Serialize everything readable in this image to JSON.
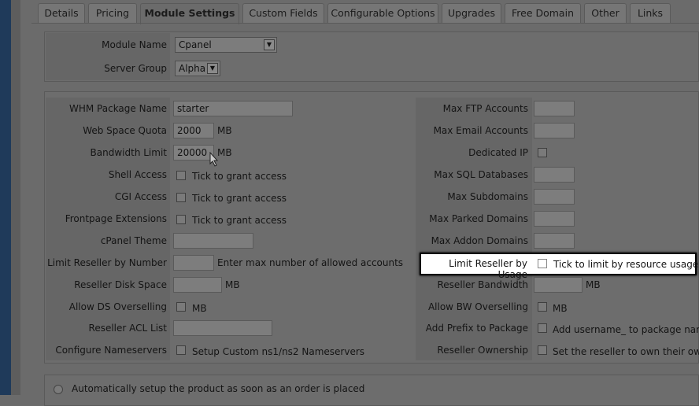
{
  "tabs": [
    "Details",
    "Pricing",
    "Module Settings",
    "Custom Fields",
    "Configurable Options",
    "Upgrades",
    "Free Domain",
    "Other",
    "Links"
  ],
  "module": {
    "module_name_label": "Module Name",
    "module_name_value": "Cpanel",
    "server_group_label": "Server Group",
    "server_group_value": "Alpha"
  },
  "left": {
    "whm_label": "WHM Package Name",
    "whm_value": "starter",
    "webspace_label": "Web Space Quota",
    "webspace_value": "2000",
    "webspace_unit": "MB",
    "bandwidth_label": "Bandwidth Limit",
    "bandwidth_value": "20000",
    "bandwidth_unit": "MB",
    "shell_label": "Shell Access",
    "shell_text": "Tick to grant access",
    "cgi_label": "CGI Access",
    "cgi_text": "Tick to grant access",
    "frontpage_label": "Frontpage Extensions",
    "frontpage_text": "Tick to grant access",
    "theme_label": "cPanel Theme",
    "limit_number_label": "Limit Reseller by Number",
    "limit_number_text": "Enter max number of allowed accounts",
    "disk_label": "Reseller Disk Space",
    "disk_unit": "MB",
    "ds_label": "Allow DS Overselling",
    "ds_unit": "MB",
    "acl_label": "Reseller ACL List",
    "ns_label": "Configure Nameservers",
    "ns_text": "Setup Custom ns1/ns2 Nameservers"
  },
  "right": {
    "ftp_label": "Max FTP Accounts",
    "email_label": "Max Email Accounts",
    "ip_label": "Dedicated IP",
    "sql_label": "Max SQL Databases",
    "sub_label": "Max Subdomains",
    "parked_label": "Max Parked Domains",
    "addon_label": "Max Addon Domains",
    "limit_usage_label": "Limit Reseller by Usage",
    "limit_usage_text": "Tick to limit by resource usage",
    "bw_label": "Reseller Bandwidth",
    "bw_unit": "MB",
    "bwover_label": "Allow BW Overselling",
    "bwover_unit": "MB",
    "prefix_label": "Add Prefix to Package",
    "prefix_text": "Add username_ to package name",
    "owner_label": "Reseller Ownership",
    "owner_text": "Set the reseller to own their own"
  },
  "auto_setup": "Automatically setup the product as soon as an order is placed"
}
